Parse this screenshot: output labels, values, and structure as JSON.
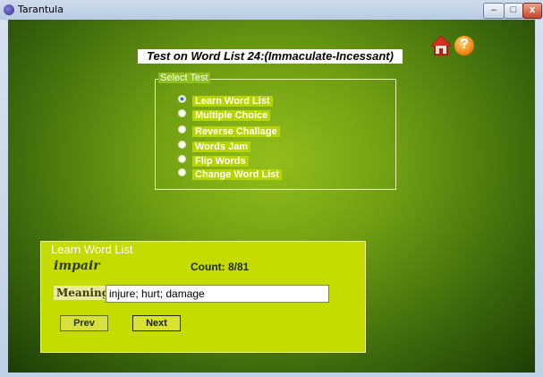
{
  "window": {
    "title": "Tarantula",
    "min_label": "–",
    "max_label": "□",
    "close_label": "x"
  },
  "heading": "Test on Word List 24:(Immaculate-Incessant)",
  "icons": {
    "home": "home-icon",
    "help": "help-icon",
    "help_glyph": "?"
  },
  "select_test": {
    "legend": "Select Test",
    "options": [
      "Learn Word List",
      "Multiple Choice",
      "Reverse Challage",
      "Words Jam",
      "Flip Words",
      "Change Word List"
    ],
    "selected_index": 0
  },
  "learn": {
    "legend": "Learn Word List",
    "word": "impair",
    "count": "Count: 8/81",
    "meaning_label": "Meaning",
    "meaning_value": "injure; hurt; damage",
    "prev_label": "Prev",
    "next_label": "Next"
  },
  "colors": {
    "accent": "#c6dc00",
    "background": "#6f9c12"
  }
}
